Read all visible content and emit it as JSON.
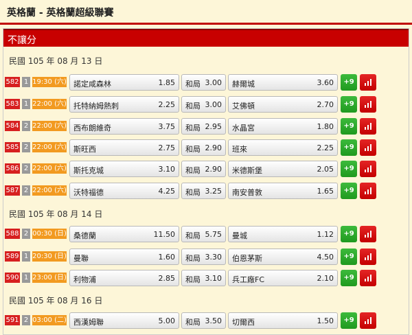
{
  "header": {
    "title": "英格蘭 - 英格蘭超級聯賽"
  },
  "section": {
    "title": "不讓分"
  },
  "groups": [
    {
      "date": "民國 105 年 08 月 13 日",
      "matches": [
        {
          "code": "582",
          "grade": "1",
          "time": "19:30 (六)",
          "home": "諾定咸森林",
          "home_odds": "1.85",
          "draw_label": "和局",
          "draw_odds": "3.00",
          "away": "赫爾城",
          "away_odds": "3.60",
          "more": "+9"
        },
        {
          "code": "583",
          "grade": "1",
          "time": "22:00 (六)",
          "home": "托特納姆熱刺",
          "home_odds": "2.25",
          "draw_label": "和局",
          "draw_odds": "3.00",
          "away": "艾佛頓",
          "away_odds": "2.70",
          "more": "+9"
        },
        {
          "code": "584",
          "grade": "2",
          "time": "22:00 (六)",
          "home": "西布朗維奇",
          "home_odds": "3.75",
          "draw_label": "和局",
          "draw_odds": "2.95",
          "away": "水晶宮",
          "away_odds": "1.80",
          "more": "+9"
        },
        {
          "code": "585",
          "grade": "2",
          "time": "22:00 (六)",
          "home": "斯旺西",
          "home_odds": "2.75",
          "draw_label": "和局",
          "draw_odds": "2.90",
          "away": "班來",
          "away_odds": "2.25",
          "more": "+9"
        },
        {
          "code": "586",
          "grade": "2",
          "time": "22:00 (六)",
          "home": "斯托克城",
          "home_odds": "3.10",
          "draw_label": "和局",
          "draw_odds": "2.90",
          "away": "米德斯堡",
          "away_odds": "2.05",
          "more": "+9"
        },
        {
          "code": "587",
          "grade": "2",
          "time": "22:00 (六)",
          "home": "沃特福德",
          "home_odds": "4.25",
          "draw_label": "和局",
          "draw_odds": "3.25",
          "away": "南安普敦",
          "away_odds": "1.65",
          "more": "+9"
        }
      ]
    },
    {
      "date": "民國 105 年 08 月 14 日",
      "matches": [
        {
          "code": "588",
          "grade": "2",
          "time": "00:30 (日)",
          "home": "桑德蘭",
          "home_odds": "11.50",
          "draw_label": "和局",
          "draw_odds": "5.75",
          "away": "曼城",
          "away_odds": "1.12",
          "more": "+9"
        },
        {
          "code": "589",
          "grade": "1",
          "time": "20:30 (日)",
          "home": "曼聯",
          "home_odds": "1.60",
          "draw_label": "和局",
          "draw_odds": "3.30",
          "away": "伯恩茅斯",
          "away_odds": "4.50",
          "more": "+9"
        },
        {
          "code": "590",
          "grade": "1",
          "time": "23:00 (日)",
          "home": "利物浦",
          "home_odds": "2.85",
          "draw_label": "和局",
          "draw_odds": "3.10",
          "away": "兵工廠FC",
          "away_odds": "2.10",
          "more": "+9"
        }
      ]
    },
    {
      "date": "民國 105 年 08 月 16 日",
      "matches": [
        {
          "code": "591",
          "grade": "2",
          "time": "03:00 (二)",
          "home": "西漢姆聯",
          "home_odds": "5.00",
          "draw_label": "和局",
          "draw_odds": "3.50",
          "away": "切爾西",
          "away_odds": "1.50",
          "more": "+9"
        }
      ]
    }
  ],
  "colors": {
    "brand_red": "#c80000",
    "code_red": "#d72020",
    "time_orange": "#f29a20",
    "more_green": "#1f9a1f",
    "background": "#fdf6d8"
  },
  "icons": {
    "stats": "bar-chart-icon"
  }
}
